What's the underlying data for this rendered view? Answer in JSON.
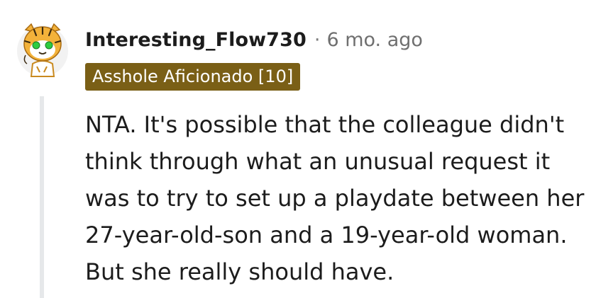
{
  "comment": {
    "author": "Interesting_Flow730",
    "separator": "·",
    "timestamp": "6 mo. ago",
    "flair": "Asshole Aficionado [10]",
    "body": "NTA. It's possible that the colleague didn't think through what an unusual request it was to try to set up a playdate between her 27-year-old-son and a 19-year-old woman. But she really should have."
  },
  "colors": {
    "flair_background": "#7a5f16",
    "thread_line": "#e6e8ea",
    "avatar_accent": "#f3b23a",
    "avatar_eyes": "#2ecc40"
  },
  "icons": {
    "avatar": "snoo-tiger-avatar-icon"
  }
}
